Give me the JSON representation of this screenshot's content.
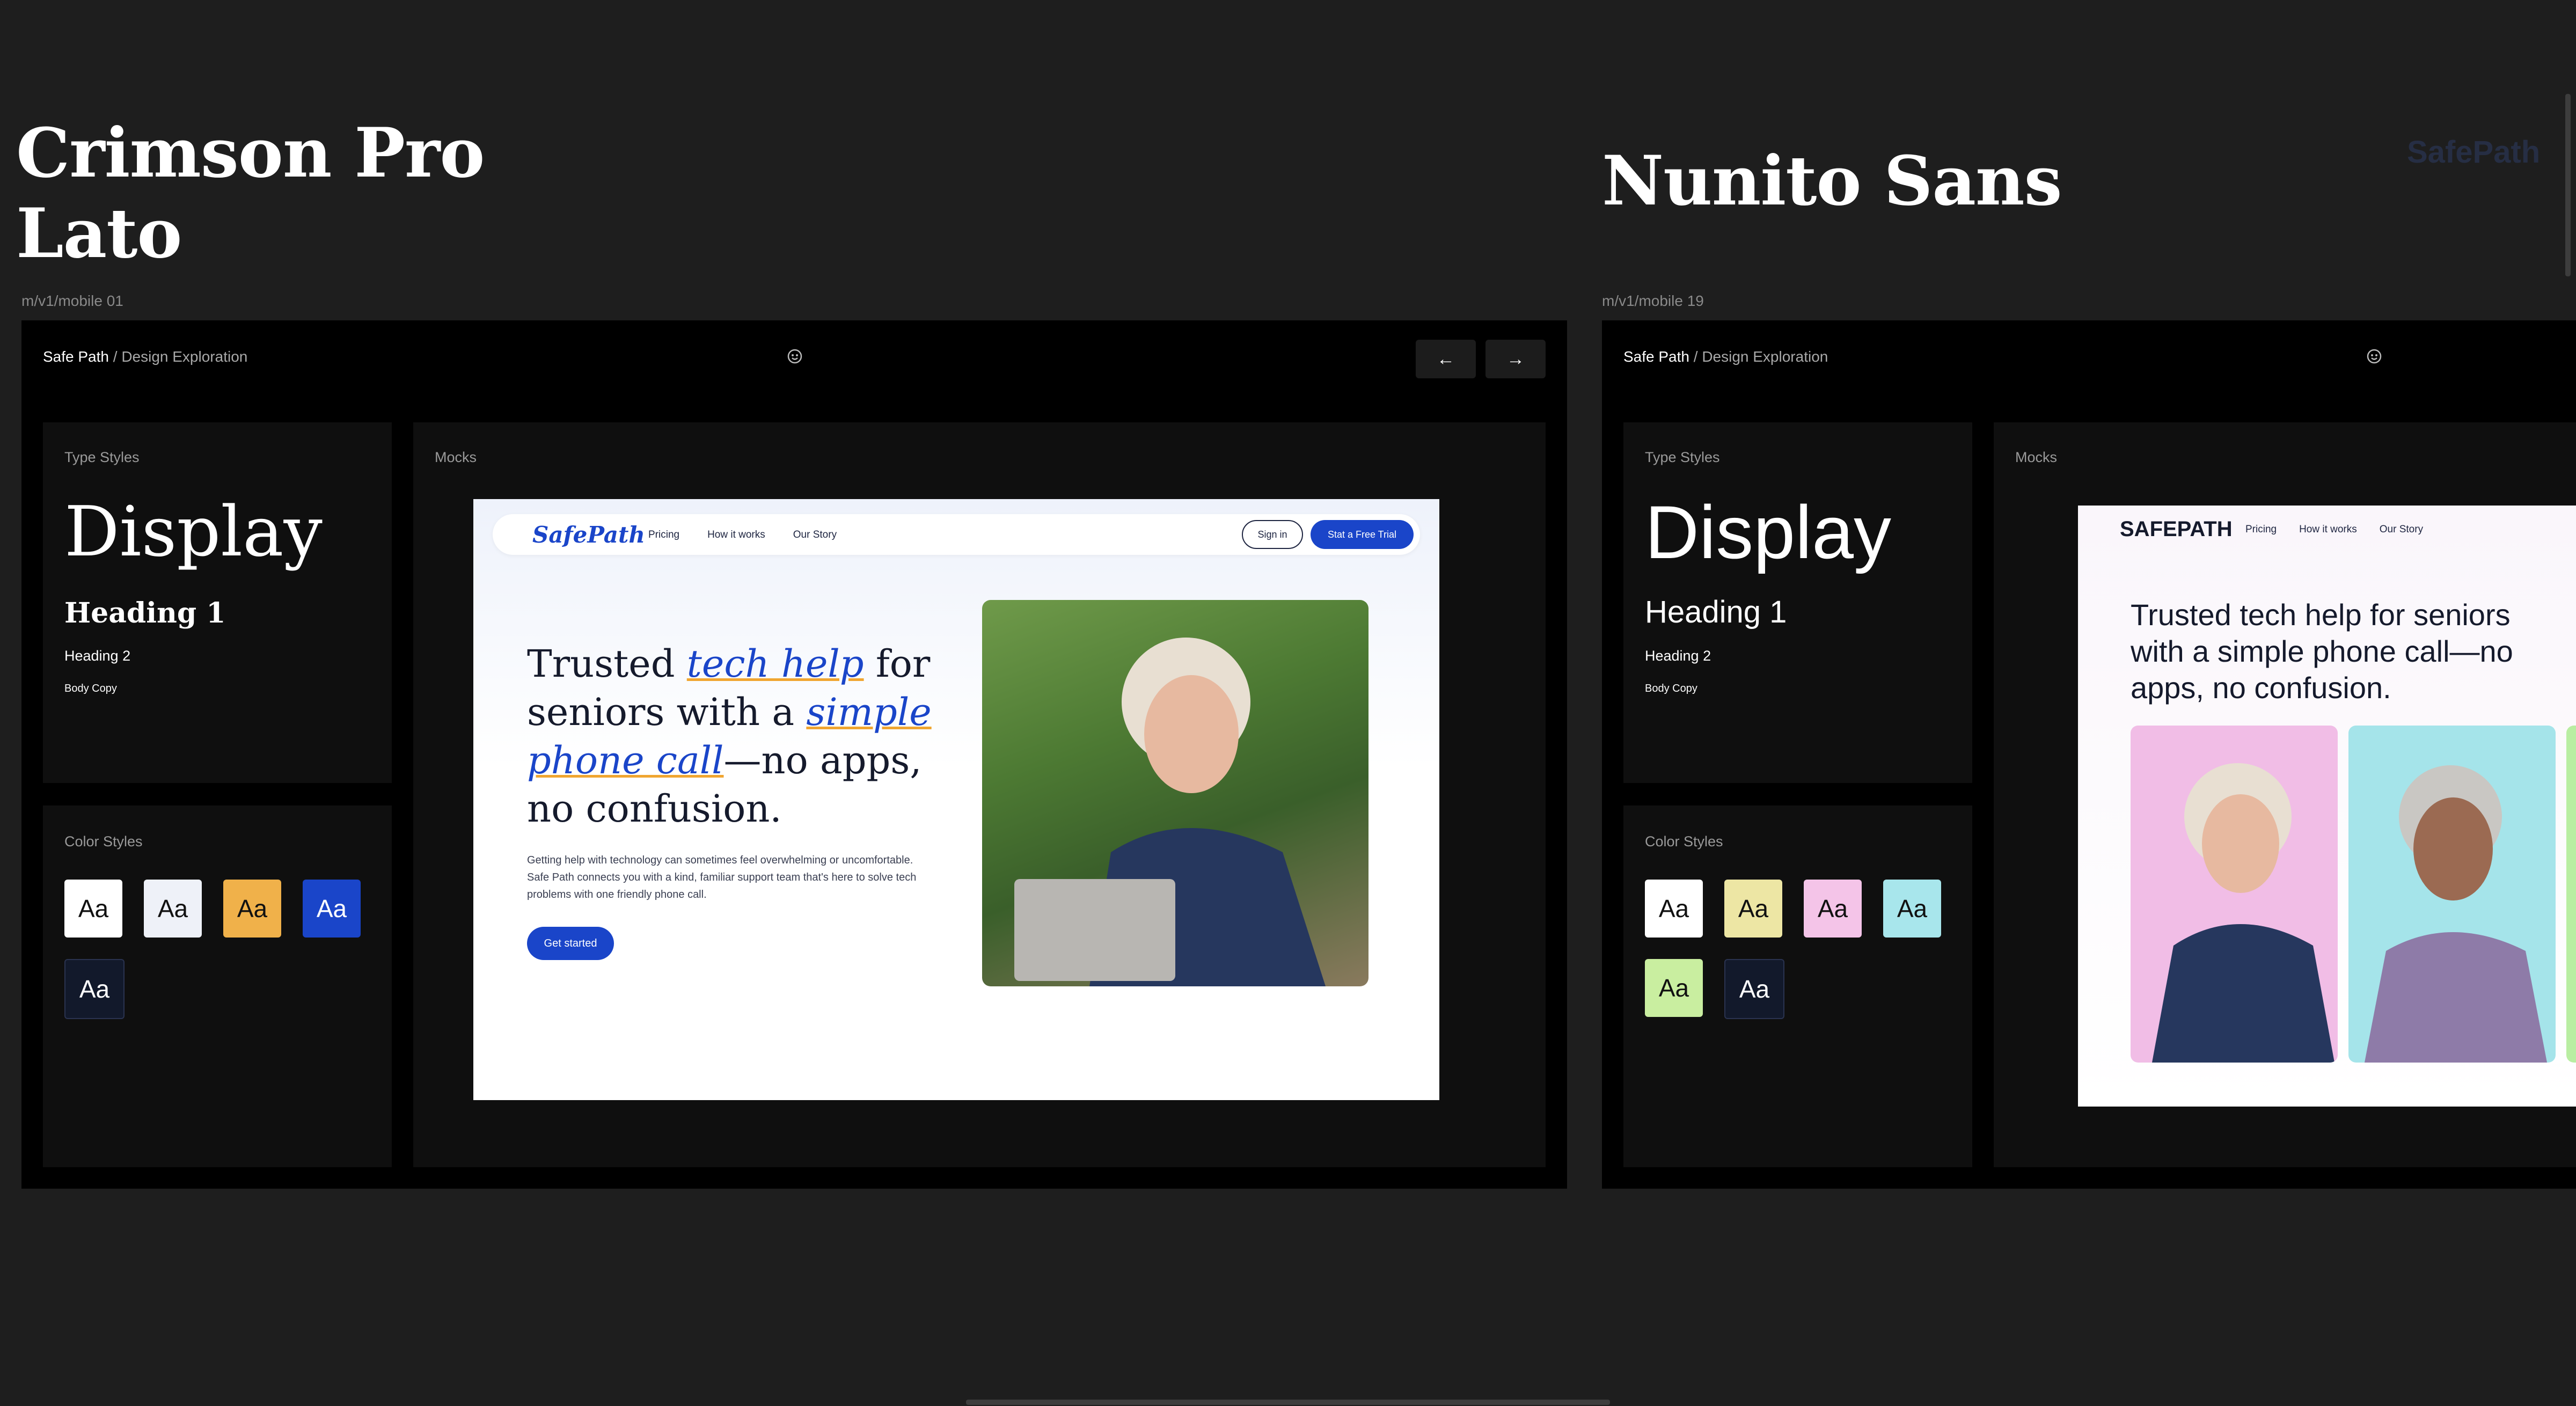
{
  "left": {
    "title_line1": "Crimson Pro",
    "title_line2": "Lato",
    "frame_label": "m/v1/mobile 01",
    "breadcrumb_project": "Safe Path",
    "breadcrumb_rest": " / Design Exploration",
    "type_styles_label": "Type Styles",
    "display": "Display",
    "heading1": "Heading 1",
    "heading2": "Heading 2",
    "body": "Body Copy",
    "color_styles_label": "Color Styles",
    "swatch_text": "Aa",
    "swatches": [
      "#ffffff",
      "#eef1f8",
      "#f0b14a",
      "#1a45c9",
      "#12192b"
    ],
    "mocks_label": "Mocks",
    "prev_icon": "arrow-left-icon",
    "next_icon": "arrow-right-icon",
    "mock": {
      "logo": "SafePath",
      "nav": [
        "Pricing",
        "How it works",
        "Our Story"
      ],
      "sign_in": "Sign in",
      "trial": "Stat a Free Trial",
      "hero_1": "Trusted ",
      "hero_em1": "tech help",
      "hero_2": " for seniors with a ",
      "hero_em2": "simple phone call",
      "hero_3": "—no apps, no confusion.",
      "body": "Getting help with technology can sometimes feel overwhelming or uncomfortable. Safe Path connects you with a kind, familiar support team that's here to solve tech problems with one friendly phone call.",
      "cta": "Get started",
      "photo": "senior-woman-on-phone-photo"
    }
  },
  "right": {
    "title": "Nunito Sans",
    "ghost_logo": "SafePath",
    "frame_label": "m/v1/mobile 19",
    "breadcrumb_project": "Safe Path",
    "breadcrumb_rest": " / Design Exploration",
    "type_styles_label": "Type Styles",
    "display": "Display",
    "heading1": "Heading 1",
    "heading2": "Heading 2",
    "body": "Body Copy",
    "color_styles_label": "Color Styles",
    "swatch_text": "Aa",
    "swatches": [
      "#ffffff",
      "#ede6a4",
      "#f4c4e8",
      "#a8e6ec",
      "#c9eea0",
      "#12192b"
    ],
    "mocks_label": "Mocks",
    "mock": {
      "logo": "SAFEPATH",
      "nav": [
        "Pricing",
        "How it works",
        "Our Story"
      ],
      "hero": "Trusted tech help for seniors with a simple phone call—no apps, no confusion.",
      "photo1": "senior-woman-on-phone-pink-photo",
      "photo2": "senior-woman-on-phone-teal-photo"
    }
  },
  "colors": {
    "canvas": "#1e1e1e",
    "brand_blue": "#1a45c9",
    "accent_orange": "#f0a530"
  }
}
